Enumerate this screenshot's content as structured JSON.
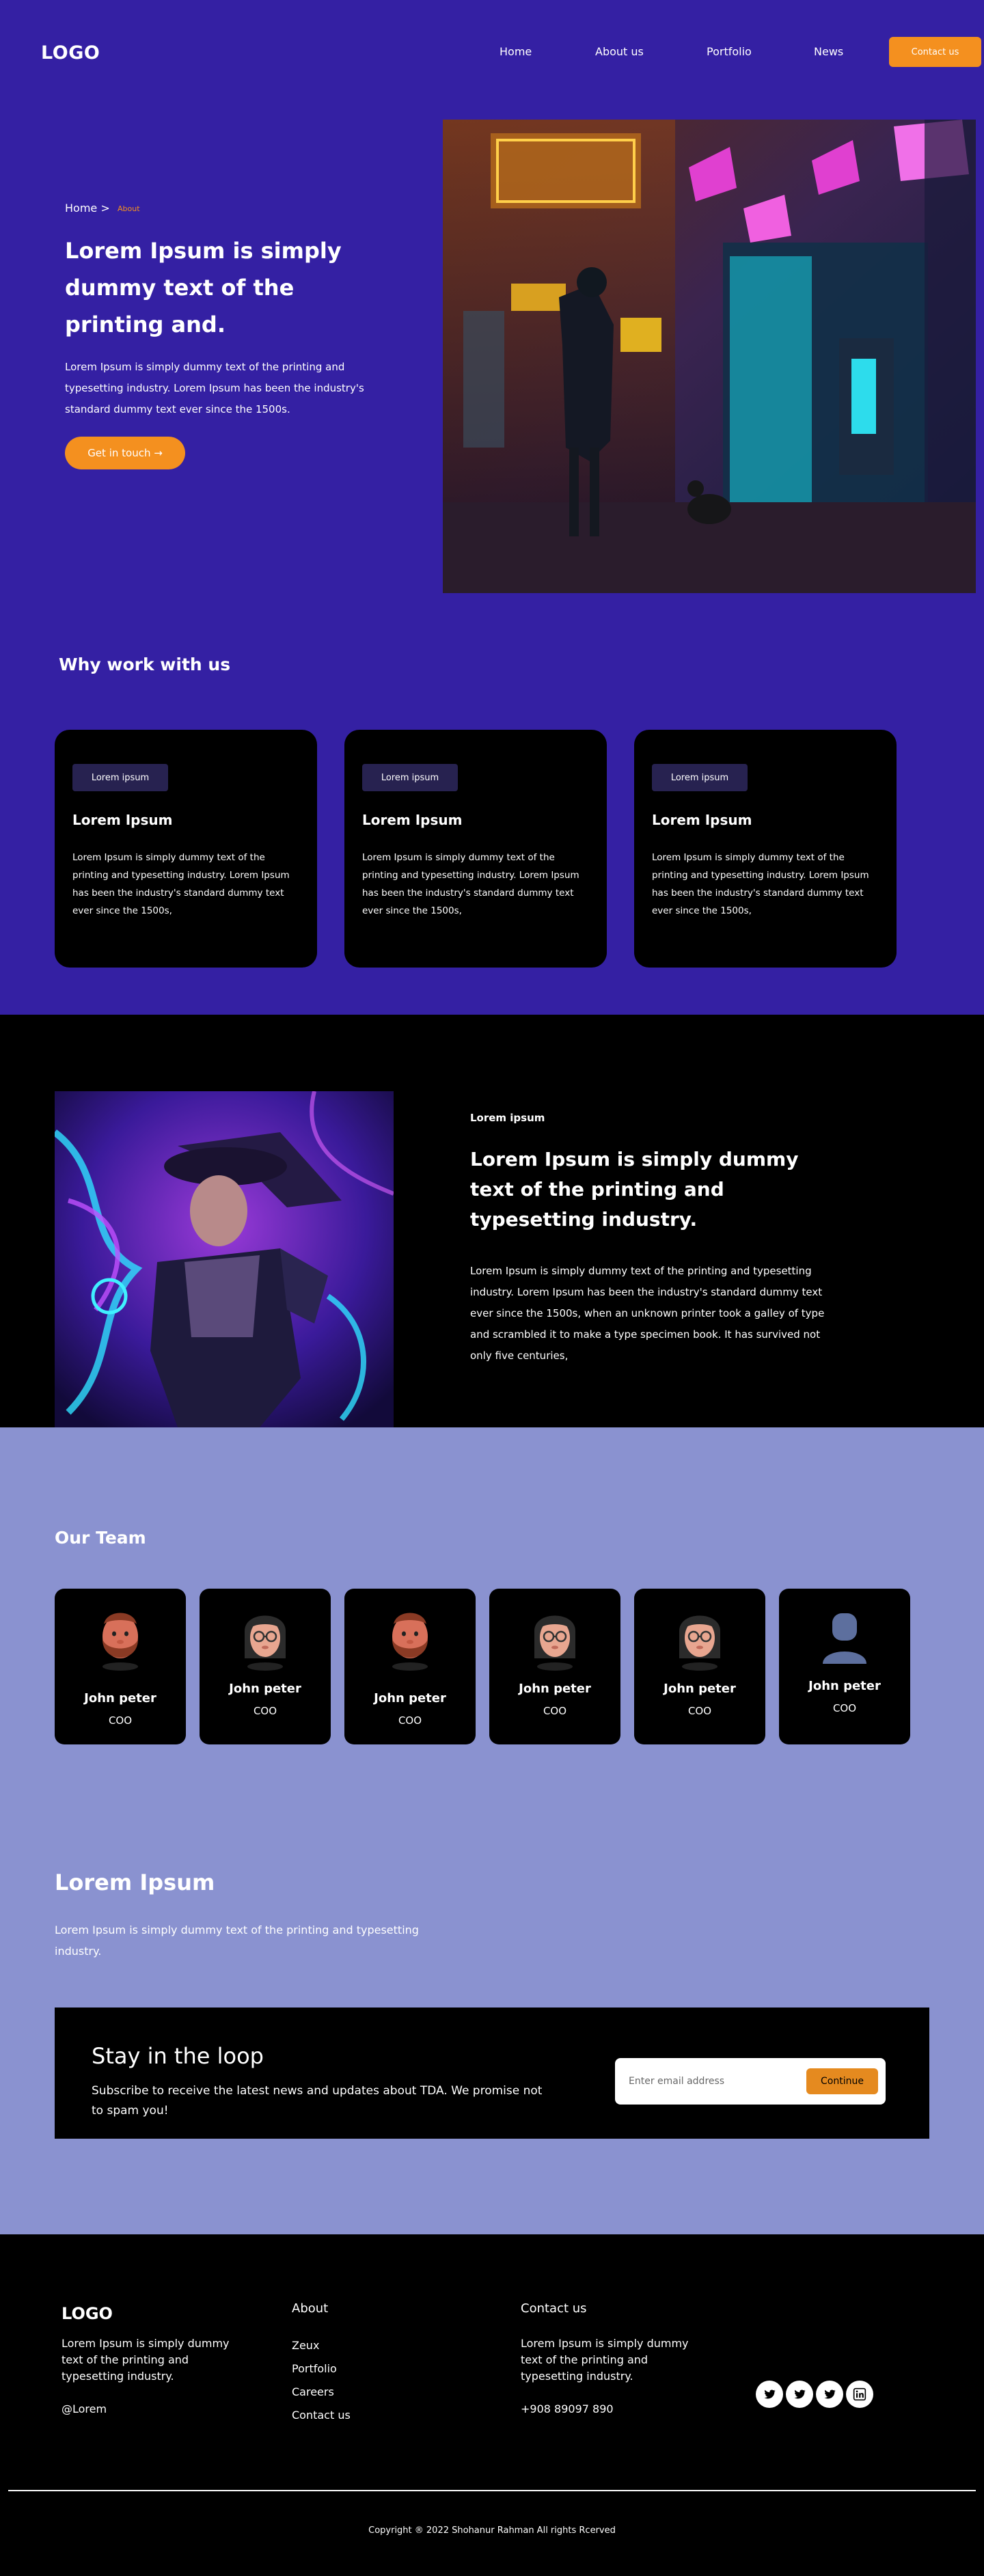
{
  "header": {
    "logo": "LOGO",
    "nav": [
      "Home",
      "About us",
      "Portfolio",
      "News"
    ],
    "cta": "Contact us"
  },
  "hero": {
    "breadcrumb_home": "Home >",
    "breadcrumb_current": "About",
    "title": "Lorem Ipsum is simply dummy text of the printing and.",
    "text": "Lorem Ipsum is simply dummy text of the printing and typesetting industry. Lorem Ipsum has been the industry's standard dummy text ever since the 1500s.",
    "button": "Get in touch →"
  },
  "why": {
    "title": "Why work with us",
    "cards": [
      {
        "tag": "Lorem ipsum",
        "title": "Lorem Ipsum",
        "text": "Lorem Ipsum is simply dummy text of the printing and typesetting industry. Lorem Ipsum has been the industry's standard dummy text ever since the 1500s,"
      },
      {
        "tag": "Lorem ipsum",
        "title": "Lorem Ipsum",
        "text": "Lorem Ipsum is simply dummy text of the printing and typesetting industry. Lorem Ipsum has been the industry's standard dummy text ever since the 1500s,"
      },
      {
        "tag": "Lorem ipsum",
        "title": "Lorem Ipsum",
        "text": "Lorem Ipsum is simply dummy text of the printing and typesetting industry. Lorem Ipsum has been the industry's standard dummy text ever since the 1500s,"
      }
    ]
  },
  "feature": {
    "eyebrow": "Lorem ipsum",
    "title": "Lorem Ipsum is simply dummy text of the printing and typesetting industry.",
    "text": "Lorem Ipsum is simply dummy text of the printing and typesetting industry. Lorem Ipsum has been the industry's standard dummy text ever since the 1500s, when an unknown printer took a galley of type and scrambled it to make a type specimen book. It has survived not only five centuries,"
  },
  "team": {
    "title": "Our Team",
    "members": [
      {
        "name": "John peter",
        "role": "COO",
        "avatar": "bearded-man-avatar"
      },
      {
        "name": "John peter",
        "role": "COO",
        "avatar": "glasses-woman-avatar"
      },
      {
        "name": "John peter",
        "role": "COO",
        "avatar": "bearded-man-avatar"
      },
      {
        "name": "John peter",
        "role": "COO",
        "avatar": "glasses-woman-avatar"
      },
      {
        "name": "John peter",
        "role": "COO",
        "avatar": "glasses-woman-avatar"
      },
      {
        "name": "John peter",
        "role": "COO",
        "avatar": "placeholder-user-avatar"
      }
    ]
  },
  "lorem": {
    "title": "Lorem Ipsum",
    "text": "Lorem Ipsum is simply dummy text of the printing and typesetting industry."
  },
  "newsletter": {
    "title": "Stay in the loop",
    "text": "Subscribe to receive the latest news and updates about TDA. We promise not to spam you!",
    "placeholder": "Enter email address",
    "button": "Continue"
  },
  "footer": {
    "logo": "LOGO",
    "description": "Lorem Ipsum is simply dummy text of the printing and typesetting industry.",
    "handle": "@Lorem",
    "about_heading": "About",
    "about_links": [
      "Zeux",
      "Portfolio",
      "Careers",
      "Contact us"
    ],
    "contact_heading": "Contact us",
    "contact_description": "Lorem Ipsum is simply dummy text of the printing and typesetting industry.",
    "phone": "+908 89097 890",
    "social_icons": [
      "twitter-icon",
      "twitter-icon",
      "twitter-icon",
      "linkedin-icon"
    ],
    "copyright": "Copyright ® 2022 Shohanur Rahman All rights Rcerved"
  },
  "colors": {
    "hero_bg": "#3420a3",
    "accent": "#f4901f",
    "team_bg": "#8a92d0",
    "card_bg": "#000000",
    "tag_bg": "#272250"
  }
}
